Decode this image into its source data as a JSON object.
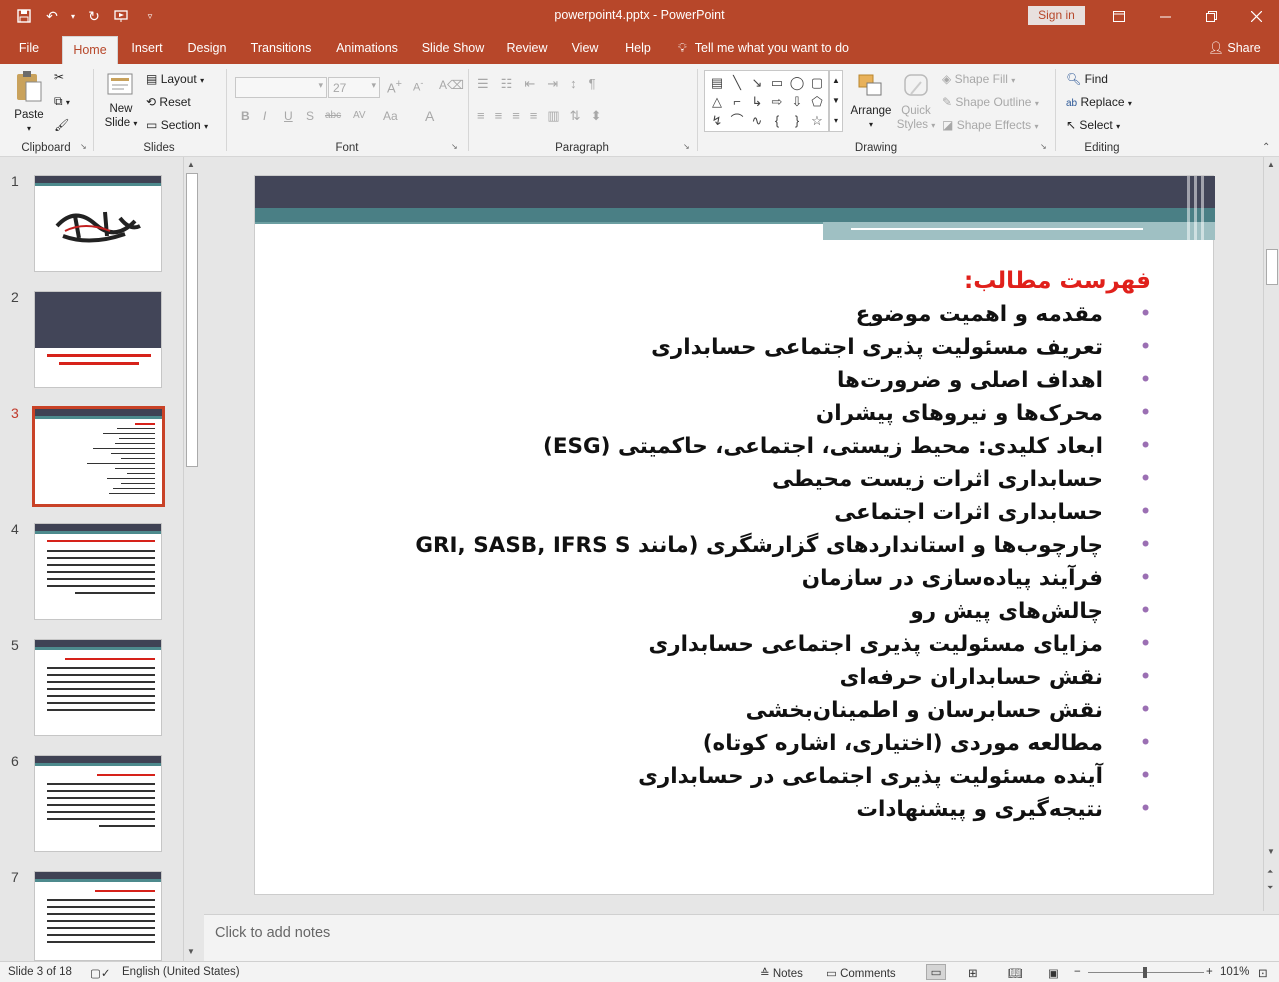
{
  "window": {
    "title": "powerpoint4.pptx - PowerPoint",
    "signin_label": "Sign in"
  },
  "tabs": [
    "File",
    "Home",
    "Insert",
    "Design",
    "Transitions",
    "Animations",
    "Slide Show",
    "Review",
    "View",
    "Help"
  ],
  "active_tab": "Home",
  "tellme": "Tell me what you want to do",
  "share_label": "Share",
  "ribbon": {
    "clipboard": {
      "label": "Clipboard",
      "paste": "Paste"
    },
    "slides": {
      "label": "Slides",
      "new_slide_1": "New",
      "new_slide_2": "Slide",
      "layout": "Layout",
      "reset": "Reset",
      "section": "Section"
    },
    "font": {
      "label": "Font",
      "font_size": "27",
      "buttons": [
        "B",
        "I",
        "U",
        "S",
        "abc",
        "AV",
        "Aa",
        "A"
      ]
    },
    "paragraph": {
      "label": "Paragraph"
    },
    "drawing": {
      "label": "Drawing",
      "arrange": "Arrange",
      "quick_styles_1": "Quick",
      "quick_styles_2": "Styles",
      "shape_fill": "Shape Fill",
      "shape_outline": "Shape Outline",
      "shape_effects": "Shape Effects"
    },
    "editing": {
      "label": "Editing",
      "find": "Find",
      "replace": "Replace",
      "select": "Select"
    }
  },
  "thumbnails": {
    "numbers": [
      "1",
      "2",
      "3",
      "4",
      "5",
      "6",
      "7"
    ],
    "selected": "3"
  },
  "slide": {
    "title": "فهرست مطالب:",
    "items": [
      "مقدمه و اهمیت موضوع",
      "تعریف مسئولیت پذیری اجتماعی حسابداری",
      "اهداف اصلی و ضرورت‌ها",
      "محرک‌ها و نیروهای پیشران",
      "ابعاد کلیدی: محیط زیستی، اجتماعی، حاکمیتی (ESG)",
      "حسابداری اثرات زیست محیطی",
      "حسابداری اثرات اجتماعی",
      "چارچوب‌ها و استانداردهای گزارشگری (مانند GRI, SASB, IFRS S",
      "فرآیند پیاده‌سازی در سازمان",
      "چالش‌های پیش رو",
      "مزایای مسئولیت پذیری اجتماعی حسابداری",
      "نقش حسابداران حرفه‌ای",
      "نقش حسابرسان و اطمینان‌بخشی",
      "مطالعه موردی (اختیاری، اشاره کوتاه)",
      "آینده مسئولیت پذیری اجتماعی در حسابداری",
      "نتیجه‌گیری و پیشنهادات"
    ]
  },
  "notes_placeholder": "Click to add notes",
  "status": {
    "slide": "Slide 3 of 18",
    "language": "English (United States)",
    "notes": "Notes",
    "comments": "Comments",
    "zoom": "101%"
  },
  "colors": {
    "accent": "#b7472a",
    "header_dark": "#424558",
    "header_teal": "#4a7f85",
    "bullet": "#9b6fb3",
    "title_red": "#e0201b"
  }
}
